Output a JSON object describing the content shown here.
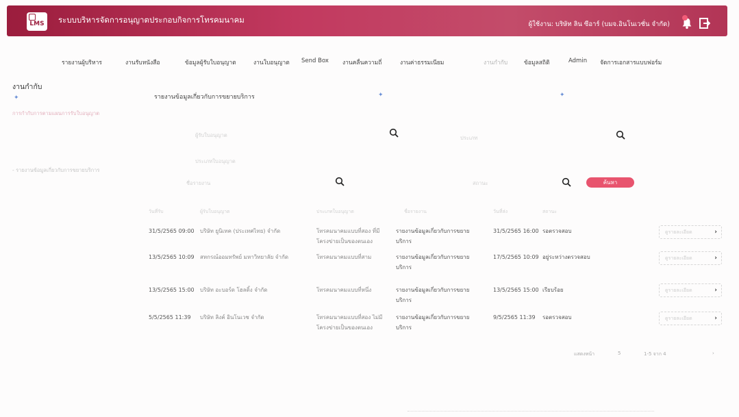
{
  "header": {
    "logo_text": "LMS",
    "app_title": "ระบบบริหารจัดการอนุญาตประกอบกิจการโทรคมนาคม",
    "user_info": "ผู้ใช้งาน: บริษัท ลิน ซีอาร์ (บมจ.อินโนเวชั่น จำกัด)",
    "notification_badge_color": "#f25c78",
    "brand_color": "#b02f53"
  },
  "nav": [
    {
      "label": "รายงานผู้บริหาร",
      "muted": false
    },
    {
      "label": "งานรับหนังสือ",
      "muted": false
    },
    {
      "label": "ข้อมูลผู้รับใบอนุญาต",
      "muted": false
    },
    {
      "label": "งานใบอนุญาต",
      "muted": false
    },
    {
      "label": "Send Box",
      "muted": false
    },
    {
      "label": "งานคลื่นความถี่",
      "muted": false
    },
    {
      "label": "งานค่าธรรมเนียม",
      "muted": false
    },
    {
      "label": "งานกำกับ",
      "muted": true
    },
    {
      "label": "ข้อมูลสถิติ",
      "muted": false
    },
    {
      "label": "Admin",
      "muted": false
    },
    {
      "label": "จัดการเอกสารแบบฟอร์ม",
      "muted": false
    }
  ],
  "page": {
    "title": "งานกำกับ",
    "sub_link": "การกำกับการตามแผนการรับใบอนุญาต",
    "side_item": "- รายงานข้อมูลเกี่ยวกับการขยายบริการ",
    "breadcrumb": "รายงานข้อมูลเกี่ยวกับการขยายบริการ"
  },
  "filters": {
    "field1": "ผู้รับใบอนุญาต",
    "field2": "ประเภท",
    "field3": "ประเภทใบอนุญาต",
    "field4": "ชื่อรายงาน",
    "field5": "สถานะ",
    "search_label": "ค้นหา"
  },
  "table": {
    "headers": [
      "วันที่รับ",
      "ผู้รับใบอนุญาต",
      "ประเภทใบอนุญาต",
      "ชื่อรายงาน",
      "วันที่ส่ง",
      "สถานะ"
    ],
    "rows": [
      {
        "date": "31/5/2565 09:00",
        "company": "บริษัท ยูนิเทค (ประเทศไทย) จำกัด",
        "license": "โทรคมนาคมแบบที่สอง ที่มีโครงข่ายเป็นของตนเอง",
        "report": "รายงานข้อมูลเกี่ยวกับการขยายบริการ",
        "sent": "31/5/2565 16:00",
        "status": "รอตรวจสอบ",
        "action": "ดูรายละเอียด"
      },
      {
        "date": "13/5/2565 10:09",
        "company": "สหกรณ์ออมทรัพย์ มหาวิทยาลัย จำกัด",
        "license": "โทรคมนาคมแบบที่สาม",
        "report": "รายงานข้อมูลเกี่ยวกับการขยายบริการ",
        "sent": "17/5/2565 10:09",
        "status": "อยู่ระหว่างตรวจสอบ",
        "action": "ดูรายละเอียด"
      },
      {
        "date": "13/5/2565 15:00",
        "company": "บริษัท อะบอร์ด โฮลดิ้ง จำกัด",
        "license": "โทรคมนาคมแบบที่หนึ่ง",
        "report": "รายงานข้อมูลเกี่ยวกับการขยายบริการ",
        "sent": "13/5/2565 15:00",
        "status": "เรียบร้อย",
        "action": "ดูรายละเอียด"
      },
      {
        "date": "5/5/2565 11:39",
        "company": "บริษัท ลิงค์ อินโนเวช จำกัด",
        "license": "โทรคมนาคมแบบที่สอง ไม่มีโครงข่ายเป็นของตนเอง",
        "report": "รายงานข้อมูลเกี่ยวกับการขยายบริการ",
        "sent": "9/5/2565 11:39",
        "status": "รอตรวจสอบ",
        "action": "ดูรายละเอียด"
      }
    ]
  },
  "pagination": {
    "rows_per_page_label": "แสดงหน้า",
    "rows_per_page": "5",
    "range": "1-5 จาก 4"
  }
}
